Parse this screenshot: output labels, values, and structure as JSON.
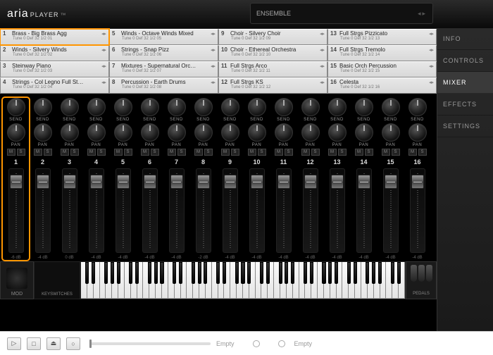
{
  "header": {
    "logo_main": "aria",
    "logo_sub": "PLAYER",
    "ensemble_label": "ENSEMBLE"
  },
  "sidebar": {
    "items": [
      {
        "label": "INFO"
      },
      {
        "label": "CONTROLS"
      },
      {
        "label": "MIXER",
        "active": true
      },
      {
        "label": "EFFECTS"
      },
      {
        "label": "SETTINGS"
      }
    ]
  },
  "slots": [
    {
      "num": "1",
      "name": "Brass - Big Brass Agg",
      "tune": "Tune   0   Def   32  1/2    01",
      "hl": true
    },
    {
      "num": "5",
      "name": "Winds - Octave Winds Mixed",
      "tune": "Tune   0   Def   32  1/2    05"
    },
    {
      "num": "9",
      "name": "Choir - Silvery Choir",
      "tune": "Tune   0   Def   32  1/2    09"
    },
    {
      "num": "13",
      "name": "Full Strgs Pizzicato",
      "tune": "Tune   0   Def   32  1/2    13"
    },
    {
      "num": "2",
      "name": "Winds - Silvery Winds",
      "tune": "Tune   0   Def   32  1/2    02"
    },
    {
      "num": "6",
      "name": "Strings - Snap Pizz",
      "tune": "Tune   0   Def   32  1/2    06"
    },
    {
      "num": "10",
      "name": "Choir - Ethereal Orchestra",
      "tune": "Tune   0   Def   32  1/2    10"
    },
    {
      "num": "14",
      "name": "Full Strgs Tremolo",
      "tune": "Tune   0   Def   32  1/2    14"
    },
    {
      "num": "3",
      "name": "Steinway Piano",
      "tune": "Tune   0   Def   32  1/2    03"
    },
    {
      "num": "7",
      "name": "Mixtures - Supernatural Orc…",
      "tune": "Tune   0   Def   32  1/2    07"
    },
    {
      "num": "11",
      "name": "Full Strgs Arco",
      "tune": "Tune   0   Def   32  1/2    11"
    },
    {
      "num": "15",
      "name": "Basic Orch Percussion",
      "tune": "Tune   0   Def   32  1/2    15"
    },
    {
      "num": "4",
      "name": "Strings - Col Legno Full St…",
      "tune": "Tune   0   Def   32  1/2    04"
    },
    {
      "num": "8",
      "name": "Percussion - Earth Drums",
      "tune": "Tune   0   Def   32  1/2    08"
    },
    {
      "num": "12",
      "name": "Full Strgs KS",
      "tune": "Tune   0   Def   32  1/2    12"
    },
    {
      "num": "16",
      "name": "Celesta",
      "tune": "Tune   0   Def   32  1/2    16"
    }
  ],
  "mixer": {
    "send_label": "SEND",
    "pan_label": "PAN",
    "mute": "M",
    "solo": "S",
    "channels": [
      {
        "n": "1",
        "db": "-6 dB",
        "hl": true,
        "hl2": true
      },
      {
        "n": "2",
        "db": "-4 dB"
      },
      {
        "n": "3",
        "db": "0 dB"
      },
      {
        "n": "4",
        "db": "-4 dB"
      },
      {
        "n": "5",
        "db": "-4 dB"
      },
      {
        "n": "6",
        "db": "-4 dB"
      },
      {
        "n": "7",
        "db": "-4 dB"
      },
      {
        "n": "8",
        "db": "-2 dB"
      },
      {
        "n": "9",
        "db": "-4 dB"
      },
      {
        "n": "10",
        "db": "-4 dB"
      },
      {
        "n": "11",
        "db": "-4 dB"
      },
      {
        "n": "12",
        "db": "-4 dB"
      },
      {
        "n": "13",
        "db": "-4 dB"
      },
      {
        "n": "14",
        "db": "-4 dB"
      },
      {
        "n": "15",
        "db": "-4 dB"
      },
      {
        "n": "16",
        "db": "-4 dB"
      }
    ]
  },
  "bottom": {
    "mod": "MOD",
    "keyswitches": "KEYSWITCHES",
    "pedals": "PEDALS"
  },
  "transport": {
    "empty": "Empty"
  }
}
